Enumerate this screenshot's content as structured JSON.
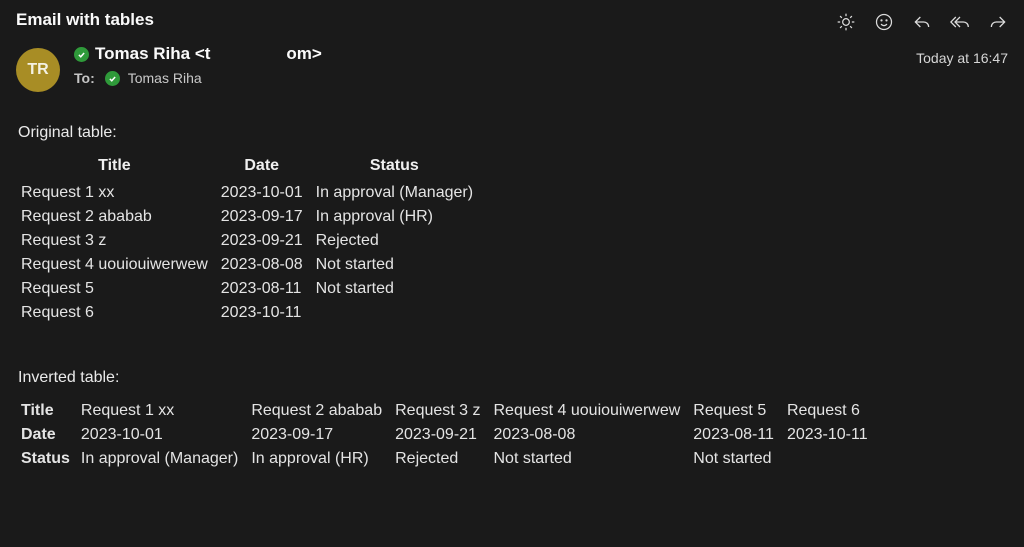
{
  "subject": "Email with tables",
  "timestamp": "Today at 16:47",
  "avatar_initials": "TR",
  "from": {
    "display": "Tomas Riha <t",
    "display_tail": "om>"
  },
  "to": {
    "label": "To:",
    "name": "Tomas Riha"
  },
  "body": {
    "original_label": "Original table:",
    "inverted_label": "Inverted table:",
    "columns": [
      "Title",
      "Date",
      "Status"
    ],
    "rows": [
      {
        "title": "Request 1 xx",
        "date": "2023-10-01",
        "status": "In approval (Manager)"
      },
      {
        "title": "Request 2 ababab",
        "date": "2023-09-17",
        "status": "In approval (HR)"
      },
      {
        "title": "Request 3 z",
        "date": "2023-09-21",
        "status": "Rejected"
      },
      {
        "title": "Request 4 uouiouiwerwew",
        "date": "2023-08-08",
        "status": "Not started"
      },
      {
        "title": "Request 5",
        "date": "2023-08-11",
        "status": "Not started"
      },
      {
        "title": "Request 6",
        "date": "2023-10-11",
        "status": ""
      }
    ]
  }
}
